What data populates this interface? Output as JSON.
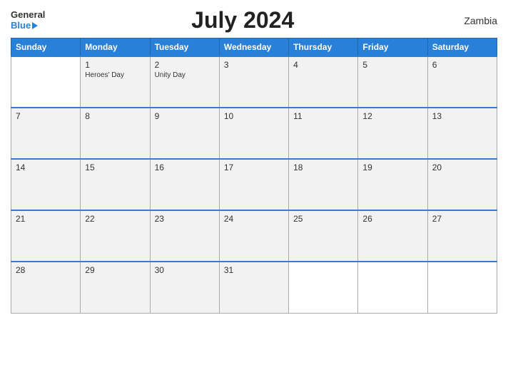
{
  "header": {
    "logo_general": "General",
    "logo_blue": "Blue",
    "title": "July 2024",
    "country": "Zambia"
  },
  "weekdays": [
    "Sunday",
    "Monday",
    "Tuesday",
    "Wednesday",
    "Thursday",
    "Friday",
    "Saturday"
  ],
  "weeks": [
    [
      {
        "day": "",
        "event": "",
        "empty": true
      },
      {
        "day": "1",
        "event": "Heroes' Day"
      },
      {
        "day": "2",
        "event": "Unity Day"
      },
      {
        "day": "3",
        "event": ""
      },
      {
        "day": "4",
        "event": ""
      },
      {
        "day": "5",
        "event": ""
      },
      {
        "day": "6",
        "event": ""
      }
    ],
    [
      {
        "day": "7",
        "event": ""
      },
      {
        "day": "8",
        "event": ""
      },
      {
        "day": "9",
        "event": ""
      },
      {
        "day": "10",
        "event": ""
      },
      {
        "day": "11",
        "event": ""
      },
      {
        "day": "12",
        "event": ""
      },
      {
        "day": "13",
        "event": ""
      }
    ],
    [
      {
        "day": "14",
        "event": ""
      },
      {
        "day": "15",
        "event": ""
      },
      {
        "day": "16",
        "event": ""
      },
      {
        "day": "17",
        "event": ""
      },
      {
        "day": "18",
        "event": ""
      },
      {
        "day": "19",
        "event": ""
      },
      {
        "day": "20",
        "event": ""
      }
    ],
    [
      {
        "day": "21",
        "event": ""
      },
      {
        "day": "22",
        "event": ""
      },
      {
        "day": "23",
        "event": ""
      },
      {
        "day": "24",
        "event": ""
      },
      {
        "day": "25",
        "event": ""
      },
      {
        "day": "26",
        "event": ""
      },
      {
        "day": "27",
        "event": ""
      }
    ],
    [
      {
        "day": "28",
        "event": ""
      },
      {
        "day": "29",
        "event": ""
      },
      {
        "day": "30",
        "event": ""
      },
      {
        "day": "31",
        "event": ""
      },
      {
        "day": "",
        "event": "",
        "empty": true
      },
      {
        "day": "",
        "event": "",
        "empty": true
      },
      {
        "day": "",
        "event": "",
        "empty": true
      }
    ]
  ]
}
